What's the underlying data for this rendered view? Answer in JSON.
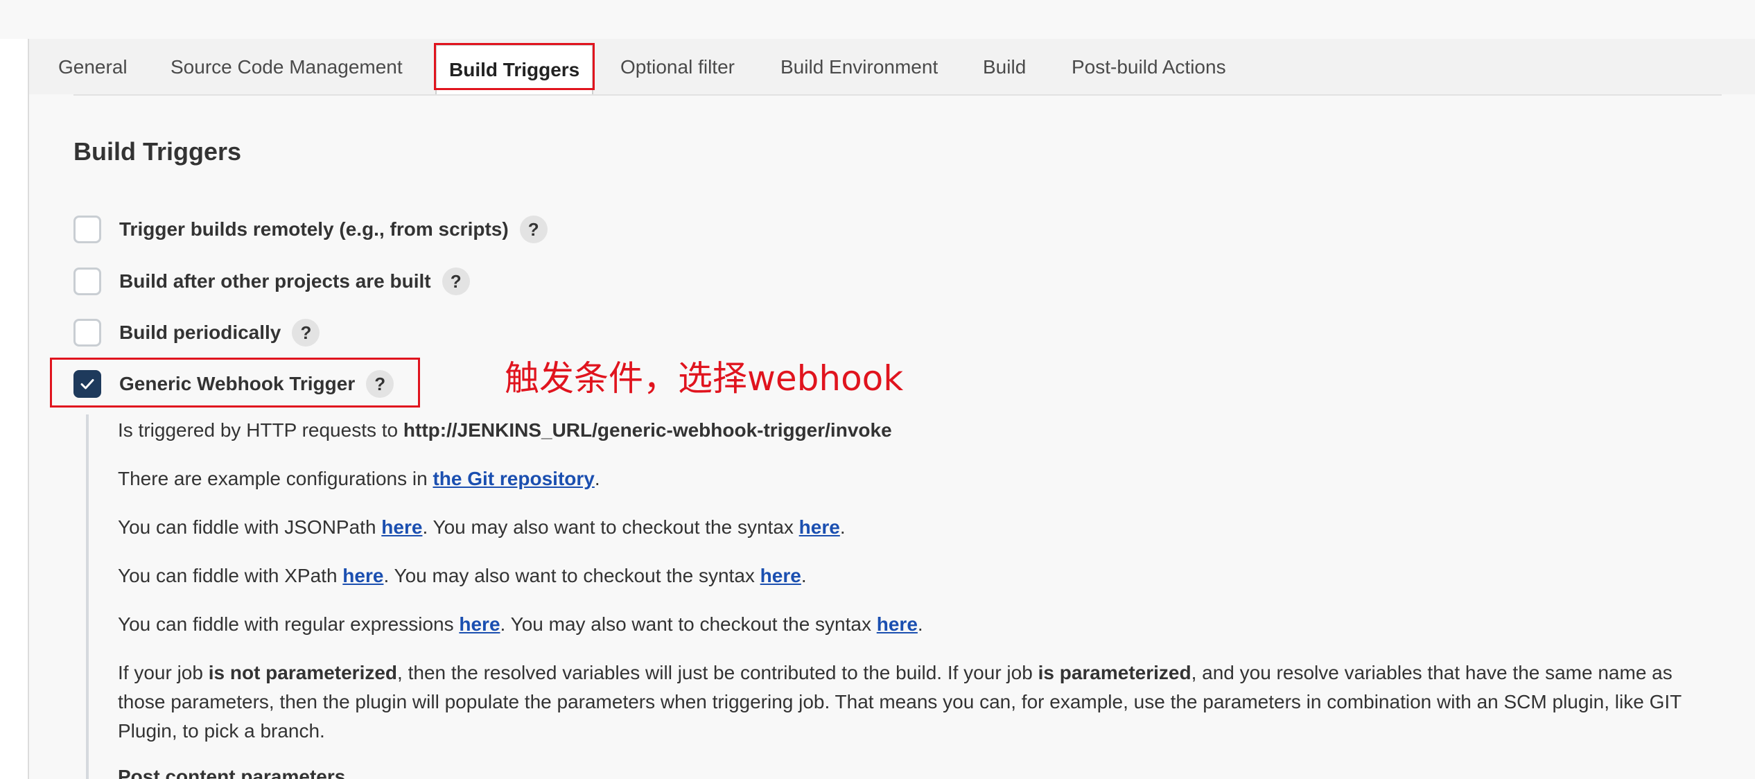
{
  "tabs": [
    {
      "label": "General",
      "active": false
    },
    {
      "label": "Source Code Management",
      "active": false
    },
    {
      "label": "Build Triggers",
      "active": true
    },
    {
      "label": "Optional filter",
      "active": false
    },
    {
      "label": "Build Environment",
      "active": false
    },
    {
      "label": "Build",
      "active": false
    },
    {
      "label": "Post-build Actions",
      "active": false
    }
  ],
  "section": {
    "title": "Build Triggers",
    "triggers": [
      {
        "label": "Trigger builds remotely (e.g., from scripts)",
        "checked": false,
        "help": "?"
      },
      {
        "label": "Build after other projects are built",
        "checked": false,
        "help": "?"
      },
      {
        "label": "Build periodically",
        "checked": false,
        "help": "?"
      },
      {
        "label": "Generic Webhook Trigger",
        "checked": true,
        "help": "?"
      }
    ]
  },
  "annotation": "触发条件，选择webhook",
  "description": {
    "p1": {
      "text": "Is triggered by HTTP requests to ",
      "url": "http://JENKINS_URL/generic-webhook-trigger/invoke"
    },
    "p2": {
      "text": "There are example configurations in ",
      "link": "the Git repository",
      "end": "."
    },
    "p3": {
      "text": "You can fiddle with JSONPath ",
      "link1": "here",
      "mid": ". You may also want to checkout the syntax ",
      "link2": "here",
      "end": "."
    },
    "p4": {
      "text": "You can fiddle with XPath ",
      "link1": "here",
      "mid": ". You may also want to checkout the syntax ",
      "link2": "here",
      "end": "."
    },
    "p5": {
      "text": "You can fiddle with regular expressions ",
      "link1": "here",
      "mid": ". You may also want to checkout the syntax ",
      "link2": "here",
      "end": "."
    },
    "p6": {
      "t1": "If your job ",
      "b1": "is not parameterized",
      "t2": ", then the resolved variables will just be contributed to the build. If your job ",
      "b2": "is parameterized",
      "t3": ", and you resolve variables that have the same name as those parameters, then the plugin will populate the parameters when triggering job. That means you can, for example, use the parameters in combination with an SCM plugin, like GIT Plugin, to pick a branch."
    },
    "p7": "Post content parameters"
  },
  "colors": {
    "accent_red": "#e0141e",
    "checkbox_checked": "#1e3a5c",
    "link": "#1b4fb0"
  }
}
